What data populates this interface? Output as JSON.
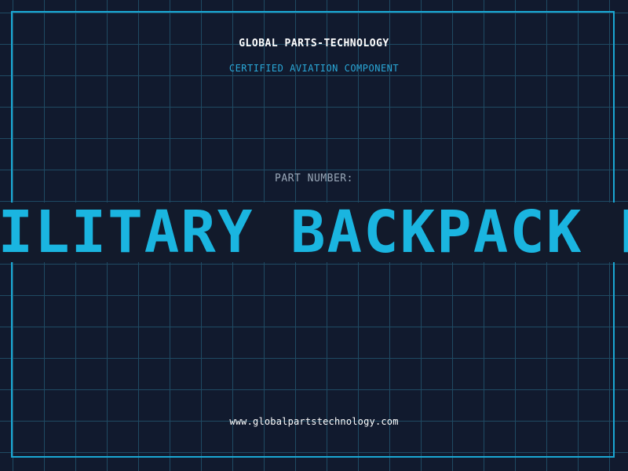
{
  "header": {
    "brand": "GLOBAL PARTS-TECHNOLOGY",
    "subtitle": "CERTIFIED AVIATION COMPONENT"
  },
  "part": {
    "label": "PART NUMBER:",
    "value": "MILITARY BACKPACK PARTS"
  },
  "footer": {
    "website": "www.globalpartstechnology.com"
  },
  "colors": {
    "background": "#111a2e",
    "grid": "#1f4a63",
    "accent": "#1ab5e0",
    "frame": "#1aa7d3",
    "label": "#9aa8b8",
    "text": "#ffffff"
  }
}
